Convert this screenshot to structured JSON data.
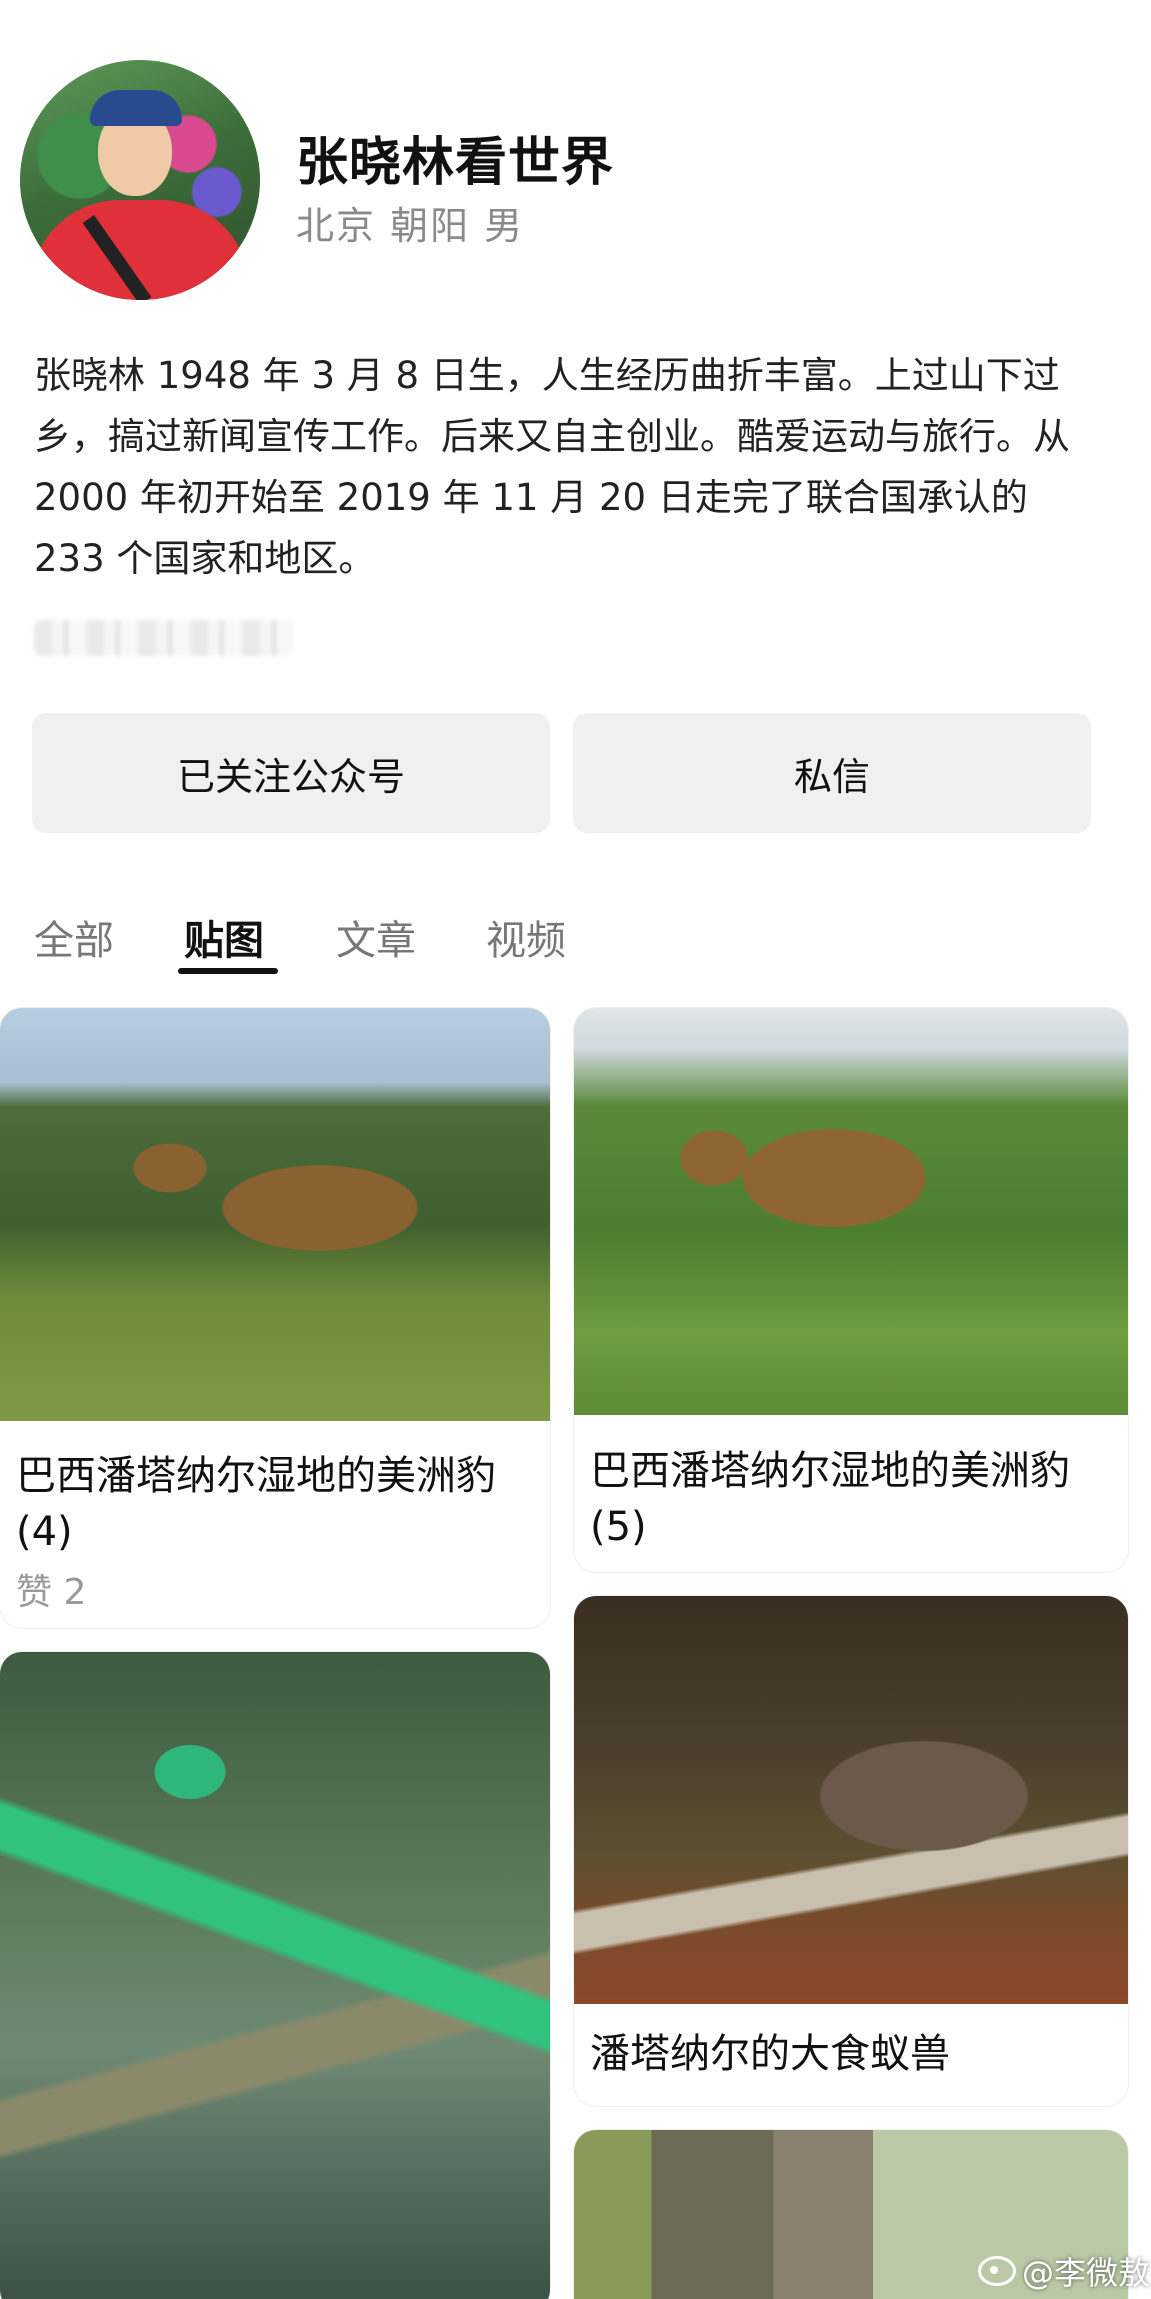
{
  "profile": {
    "name": "张晓林看世界",
    "location": "北京 朝阳 男",
    "bio": "张晓林 1948 年 3 月 8 日生，人生经历曲折丰富。上过山下过乡，搞过新闻宣传工作。后来又自主创业。酷爱运动与旅行。从 2000 年初开始至 2019 年 11 月 20 日走完了联合国承认的 233 个国家和地区。"
  },
  "actions": {
    "follow_label": "已关注公众号",
    "message_label": "私信"
  },
  "tabs": [
    {
      "label": "全部",
      "active": false
    },
    {
      "label": "贴图",
      "active": true
    },
    {
      "label": "文章",
      "active": false
    },
    {
      "label": "视频",
      "active": false
    }
  ],
  "posts": [
    {
      "title": "巴西潘塔纳尔湿地的美洲豹 (4)",
      "likes": "赞 2"
    },
    {
      "title": "巴西潘塔纳尔湿地的美洲豹 (5)"
    },
    {
      "title": "潘塔纳尔的大食蚁兽"
    }
  ],
  "watermark": {
    "text": "@李微敖"
  }
}
